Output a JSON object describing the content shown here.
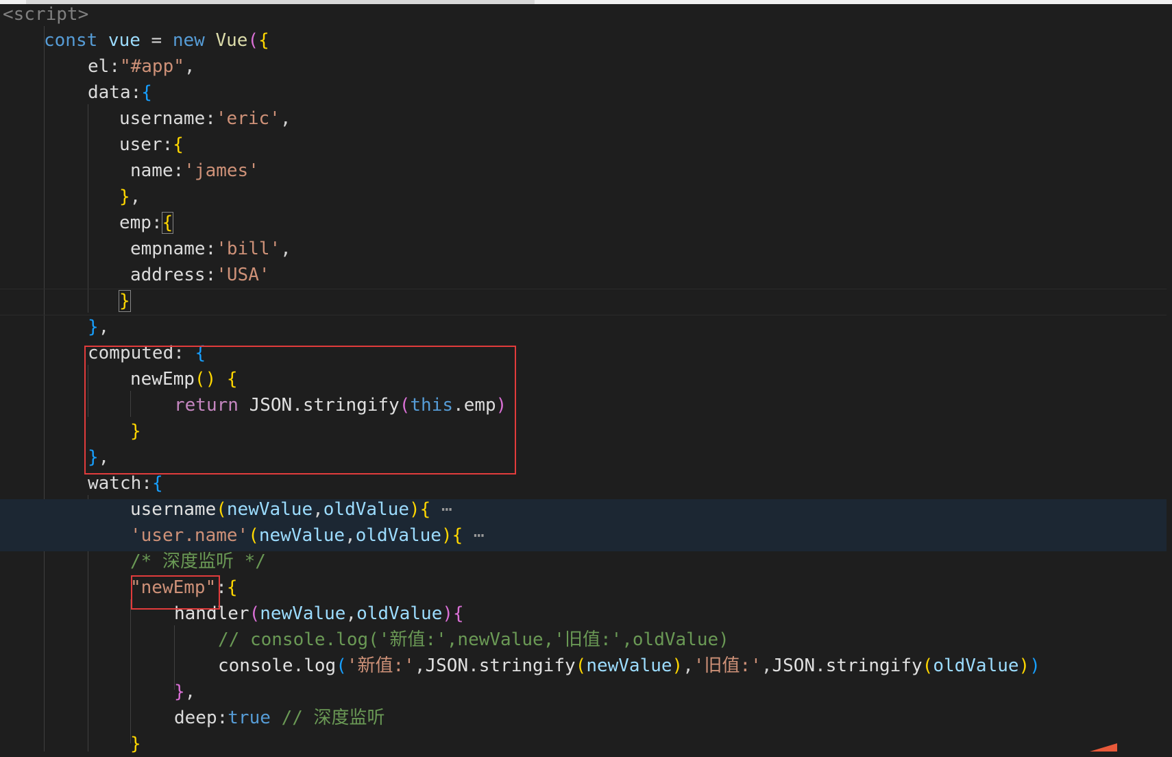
{
  "lines": [
    [
      [
        "t-tag",
        "<script>"
      ]
    ],
    [
      [
        "t-kw",
        "const "
      ],
      [
        "t-var",
        "vue "
      ],
      [
        "t-txt",
        "= "
      ],
      [
        "t-kw",
        "new "
      ],
      [
        "t-cls",
        "Vue"
      ],
      [
        "t-b2",
        "("
      ],
      [
        "t-b1",
        "{"
      ]
    ],
    [
      [
        "t-prop",
        "el"
      ],
      [
        "t-txt",
        ":"
      ],
      [
        "t-str",
        "\"#app\""
      ],
      [
        "t-txt",
        ","
      ]
    ],
    [
      [
        "t-prop",
        "data"
      ],
      [
        "t-txt",
        ":"
      ],
      [
        "t-b3",
        "{"
      ]
    ],
    [
      [
        "t-prop",
        "username"
      ],
      [
        "t-txt",
        ":"
      ],
      [
        "t-str",
        "'eric'"
      ],
      [
        "t-txt",
        ","
      ]
    ],
    [
      [
        "t-prop",
        "user"
      ],
      [
        "t-txt",
        ":"
      ],
      [
        "t-b1",
        "{"
      ]
    ],
    [
      [
        "t-prop",
        "name"
      ],
      [
        "t-txt",
        ":"
      ],
      [
        "t-str",
        "'james'"
      ]
    ],
    [
      [
        "t-b1",
        "}"
      ],
      [
        "t-txt",
        ","
      ]
    ],
    [
      [
        "t-prop",
        "emp"
      ],
      [
        "t-txt",
        ":"
      ],
      [
        "t-b1 bracket-match",
        "{"
      ]
    ],
    [
      [
        "t-prop",
        "empname"
      ],
      [
        "t-txt",
        ":"
      ],
      [
        "t-str",
        "'bill'"
      ],
      [
        "t-txt",
        ","
      ]
    ],
    [
      [
        "t-prop",
        "address"
      ],
      [
        "t-txt",
        ":"
      ],
      [
        "t-str",
        "'USA'"
      ]
    ],
    [
      [
        "t-b1 bracket-match",
        "}"
      ]
    ],
    [
      [
        "t-b3",
        "}"
      ],
      [
        "t-txt",
        ","
      ]
    ],
    [
      [
        "t-prop",
        "computed"
      ],
      [
        "t-txt",
        ": "
      ],
      [
        "t-b3",
        "{"
      ]
    ],
    [
      [
        "t-fn",
        "newEmp"
      ],
      [
        "t-b1",
        "() {"
      ]
    ],
    [
      [
        "t-kw2",
        "return "
      ],
      [
        "t-fn",
        "JSON"
      ],
      [
        "t-txt",
        "."
      ],
      [
        "t-fn",
        "stringify"
      ],
      [
        "t-b2",
        "("
      ],
      [
        "t-kw",
        "this"
      ],
      [
        "t-txt",
        "."
      ],
      [
        "t-prop",
        "emp"
      ],
      [
        "t-b2",
        ")"
      ]
    ],
    [
      [
        "t-b1",
        "}"
      ]
    ],
    [
      [
        "t-b3",
        "}"
      ],
      [
        "t-txt",
        ","
      ]
    ],
    [
      [
        "t-prop",
        "watch"
      ],
      [
        "t-txt",
        ":"
      ],
      [
        "t-b3",
        "{"
      ]
    ],
    [
      [
        "t-fn",
        "username"
      ],
      [
        "t-b1",
        "("
      ],
      [
        "t-var",
        "newValue"
      ],
      [
        "t-txt",
        ","
      ],
      [
        "t-var",
        "oldValue"
      ],
      [
        "t-b1",
        "){"
      ],
      [
        "ellipsis",
        " ⋯"
      ]
    ],
    [
      [
        "t-str",
        "'user.name'"
      ],
      [
        "t-b1",
        "("
      ],
      [
        "t-var",
        "newValue"
      ],
      [
        "t-txt",
        ","
      ],
      [
        "t-var",
        "oldValue"
      ],
      [
        "t-b1",
        "){"
      ],
      [
        "ellipsis",
        " ⋯"
      ]
    ],
    [
      [
        "t-cmt",
        "/* 深度监听 */"
      ]
    ],
    [
      [
        "t-str",
        "\"newEmp\""
      ],
      [
        "t-txt",
        ":"
      ],
      [
        "t-b1",
        "{"
      ]
    ],
    [
      [
        "t-fn",
        "handler"
      ],
      [
        "t-b2",
        "("
      ],
      [
        "t-var",
        "newValue"
      ],
      [
        "t-txt",
        ","
      ],
      [
        "t-var",
        "oldValue"
      ],
      [
        "t-b2",
        "){"
      ]
    ],
    [
      [
        "t-cmt",
        "// console.log('新值:',newValue,'旧值:',oldValue)"
      ]
    ],
    [
      [
        "t-fn",
        "console"
      ],
      [
        "t-txt",
        "."
      ],
      [
        "t-fn",
        "log"
      ],
      [
        "t-b3",
        "("
      ],
      [
        "t-str",
        "'新值:'"
      ],
      [
        "t-txt",
        ","
      ],
      [
        "t-fn",
        "JSON"
      ],
      [
        "t-txt",
        "."
      ],
      [
        "t-fn",
        "stringify"
      ],
      [
        "t-b1",
        "("
      ],
      [
        "t-var",
        "newValue"
      ],
      [
        "t-b1",
        ")"
      ],
      [
        "t-txt",
        ","
      ],
      [
        "t-str",
        "'旧值:'"
      ],
      [
        "t-txt",
        ","
      ],
      [
        "t-fn",
        "JSON"
      ],
      [
        "t-txt",
        "."
      ],
      [
        "t-fn",
        "stringify"
      ],
      [
        "t-b1",
        "("
      ],
      [
        "t-var",
        "oldValue"
      ],
      [
        "t-b1",
        ")"
      ],
      [
        "t-b3",
        ")"
      ]
    ],
    [
      [
        "t-b2",
        "}"
      ],
      [
        "t-txt",
        ","
      ]
    ],
    [
      [
        "t-prop",
        "deep"
      ],
      [
        "t-txt",
        ":"
      ],
      [
        "t-kw",
        "true "
      ],
      [
        "t-cmt",
        "// 深度监听"
      ]
    ],
    [
      [
        "t-b1",
        "}"
      ]
    ]
  ]
}
